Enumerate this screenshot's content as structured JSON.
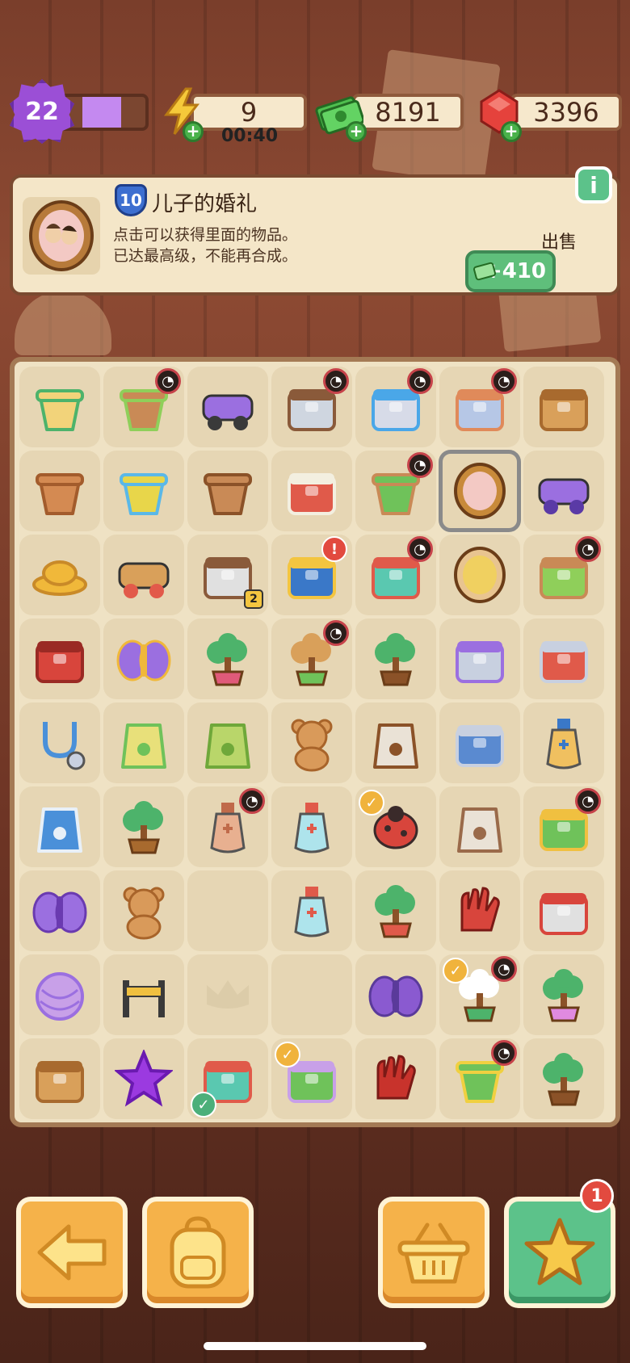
{
  "topbar": {
    "level": "22",
    "xp_fraction": 0.45,
    "energy": "9",
    "energy_timer": "00:40",
    "cash": "8191",
    "gems": "3396"
  },
  "info": {
    "item_level": "10",
    "title": "儿子的婚礼",
    "desc_line1": "点击可以获得里面的物品。",
    "desc_line2": "已达最高级，不能再合成。",
    "sell_label": "出售",
    "sell_value": "+410",
    "info_icon": "i"
  },
  "board": {
    "rows": [
      [
        {
          "name": "cup-drink",
          "badge": ""
        },
        {
          "name": "flower-pot-seeds",
          "badge": "timer"
        },
        {
          "name": "purple-scooter",
          "badge": ""
        },
        {
          "name": "evidence-tray",
          "badge": "timer"
        },
        {
          "name": "tool-tray",
          "badge": "timer"
        },
        {
          "name": "evidence-board",
          "badge": "timer"
        },
        {
          "name": "wooden-crate",
          "badge": ""
        }
      ],
      [
        {
          "name": "clay-pot",
          "badge": ""
        },
        {
          "name": "yellow-bucket",
          "badge": ""
        },
        {
          "name": "broken-pot",
          "badge": ""
        },
        {
          "name": "gift-box-red",
          "badge": ""
        },
        {
          "name": "potted-plant",
          "badge": "timer"
        },
        {
          "name": "wedding-portrait",
          "badge": "",
          "selected": true
        },
        {
          "name": "purple-car",
          "badge": ""
        }
      ],
      [
        {
          "name": "yellow-hat",
          "badge": ""
        },
        {
          "name": "cardboard-stack",
          "badge": ""
        },
        {
          "name": "evidence-box",
          "badge": "num",
          "num": "2"
        },
        {
          "name": "treasure-chest",
          "badge": "alert"
        },
        {
          "name": "medical-kit",
          "badge": "timer"
        },
        {
          "name": "groom-portrait",
          "badge": ""
        },
        {
          "name": "map-desk",
          "badge": "timer"
        }
      ],
      [
        {
          "name": "red-toolbox",
          "badge": ""
        },
        {
          "name": "purple-moth",
          "badge": ""
        },
        {
          "name": "flower-bush",
          "badge": ""
        },
        {
          "name": "plant-box",
          "badge": "timer"
        },
        {
          "name": "bonsai-small",
          "badge": ""
        },
        {
          "name": "film-roll",
          "badge": ""
        },
        {
          "name": "red-sewing-machine",
          "badge": ""
        }
      ],
      [
        {
          "name": "stethoscope",
          "badge": ""
        },
        {
          "name": "seed-sack",
          "badge": ""
        },
        {
          "name": "seed-bag",
          "badge": ""
        },
        {
          "name": "teddy-bear-honey",
          "badge": ""
        },
        {
          "name": "footprint-bag",
          "badge": ""
        },
        {
          "name": "tablet-scroll",
          "badge": ""
        },
        {
          "name": "ornate-vase",
          "badge": ""
        }
      ],
      [
        {
          "name": "iv-bag",
          "badge": ""
        },
        {
          "name": "bonsai-tree",
          "badge": ""
        },
        {
          "name": "sand-bottle",
          "badge": "timer"
        },
        {
          "name": "medicine-jar",
          "badge": ""
        },
        {
          "name": "ladybug",
          "badge": "check"
        },
        {
          "name": "evidence-bag",
          "badge": ""
        },
        {
          "name": "green-machine",
          "badge": "timer"
        }
      ],
      [
        {
          "name": "moth-small",
          "badge": ""
        },
        {
          "name": "teddy-bear",
          "badge": ""
        },
        {
          "name": "empty",
          "badge": ""
        },
        {
          "name": "medical-bottles",
          "badge": ""
        },
        {
          "name": "berry-bush",
          "badge": ""
        },
        {
          "name": "red-gloves",
          "badge": ""
        },
        {
          "name": "sewing-machine",
          "badge": ""
        }
      ],
      [
        {
          "name": "yarn-ball",
          "badge": ""
        },
        {
          "name": "caution-barrier",
          "badge": ""
        },
        {
          "name": "locked-slot",
          "badge": ""
        },
        {
          "name": "empty",
          "badge": ""
        },
        {
          "name": "purple-moth-large",
          "badge": ""
        },
        {
          "name": "cotton-plant",
          "badge": "check-timer"
        },
        {
          "name": "flowering-tree",
          "badge": ""
        }
      ],
      [
        {
          "name": "open-crate",
          "badge": ""
        },
        {
          "name": "purple-star",
          "badge": ""
        },
        {
          "name": "open-toolkit",
          "badge": "check-g"
        },
        {
          "name": "brush-scrubber",
          "badge": "check"
        },
        {
          "name": "red-glove-pair",
          "badge": ""
        },
        {
          "name": "fruit-tree-pot",
          "badge": "timer"
        },
        {
          "name": "bonsai-green",
          "badge": ""
        }
      ]
    ]
  },
  "bottom": {
    "back_icon": "arrow-left-icon",
    "bag_icon": "backpack-icon",
    "basket_icon": "basket-icon",
    "star_icon": "star-icon",
    "star_notification": "1"
  },
  "colors": {
    "accent_orange": "#f5b24a",
    "accent_green": "#5cc28a",
    "level_purple": "#9b4fd6",
    "board_bg": "#efe2c4"
  }
}
